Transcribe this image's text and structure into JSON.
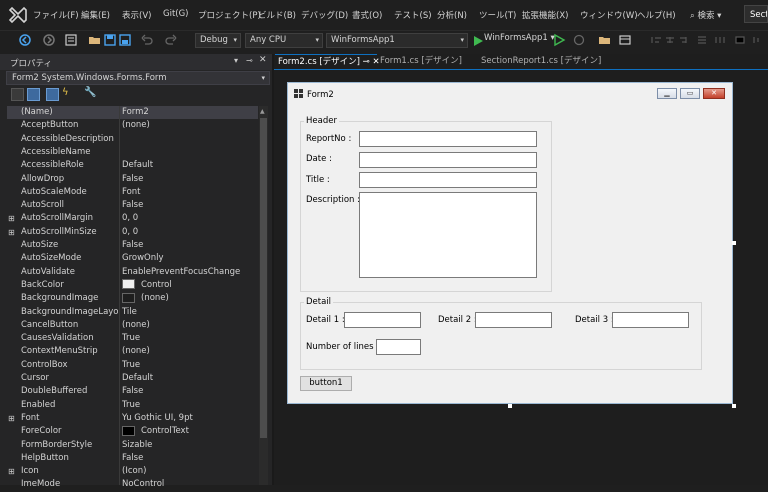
{
  "menubar": {
    "items": [
      "ファイル(F)",
      "編集(E)",
      "表示(V)",
      "Git(G)",
      "プロジェクト(P)",
      "ビルド(B)",
      "デバッグ(D)",
      "書式(O)",
      "テスト(S)",
      "分析(N)",
      "ツール(T)",
      "拡張機能(X)",
      "ウィンドウ(W)",
      "ヘルプ(H)"
    ],
    "search_label": "検索 ▾",
    "search_box_text": "Sect"
  },
  "toolbar": {
    "config": "Debug",
    "platform": "Any CPU",
    "startup_project": "WinFormsApp1",
    "run_label": "WinFormsApp1 ▾"
  },
  "properties": {
    "title": "プロパティ",
    "object": "Form2  System.Windows.Forms.Form",
    "rows": [
      {
        "exp": "",
        "name": "(Name)",
        "value": "Form2"
      },
      {
        "exp": "",
        "name": "AcceptButton",
        "value": "(none)"
      },
      {
        "exp": "",
        "name": "AccessibleDescription",
        "value": ""
      },
      {
        "exp": "",
        "name": "AccessibleName",
        "value": ""
      },
      {
        "exp": "",
        "name": "AccessibleRole",
        "value": "Default"
      },
      {
        "exp": "",
        "name": "AllowDrop",
        "value": "False"
      },
      {
        "exp": "",
        "name": "AutoScaleMode",
        "value": "Font"
      },
      {
        "exp": "",
        "name": "AutoScroll",
        "value": "False"
      },
      {
        "exp": "⊞",
        "name": "AutoScrollMargin",
        "value": "0, 0"
      },
      {
        "exp": "⊞",
        "name": "AutoScrollMinSize",
        "value": "0, 0"
      },
      {
        "exp": "",
        "name": "AutoSize",
        "value": "False"
      },
      {
        "exp": "",
        "name": "AutoSizeMode",
        "value": "GrowOnly"
      },
      {
        "exp": "",
        "name": "AutoValidate",
        "value": "EnablePreventFocusChange"
      },
      {
        "exp": "",
        "name": "BackColor",
        "value": "Control",
        "swatch": "#f0f0f0"
      },
      {
        "exp": "",
        "name": "BackgroundImage",
        "value": "(none)",
        "swatch": "#1e1e1e"
      },
      {
        "exp": "",
        "name": "BackgroundImageLayout",
        "value": "Tile"
      },
      {
        "exp": "",
        "name": "CancelButton",
        "value": "(none)"
      },
      {
        "exp": "",
        "name": "CausesValidation",
        "value": "True"
      },
      {
        "exp": "",
        "name": "ContextMenuStrip",
        "value": "(none)"
      },
      {
        "exp": "",
        "name": "ControlBox",
        "value": "True"
      },
      {
        "exp": "",
        "name": "Cursor",
        "value": "Default"
      },
      {
        "exp": "",
        "name": "DoubleBuffered",
        "value": "False"
      },
      {
        "exp": "",
        "name": "Enabled",
        "value": "True"
      },
      {
        "exp": "⊞",
        "name": "Font",
        "value": "Yu Gothic UI, 9pt"
      },
      {
        "exp": "",
        "name": "ForeColor",
        "value": "ControlText",
        "swatch": "#000000"
      },
      {
        "exp": "",
        "name": "FormBorderStyle",
        "value": "Sizable"
      },
      {
        "exp": "",
        "name": "HelpButton",
        "value": "False"
      },
      {
        "exp": "⊞",
        "name": "Icon",
        "value": "(Icon)"
      },
      {
        "exp": "",
        "name": "ImeMode",
        "value": "NoControl"
      }
    ]
  },
  "tabs": [
    {
      "label": "Form2.cs [デザイン]  ⊸ ✕"
    },
    {
      "label": "Form1.cs [デザイン]"
    },
    {
      "label": "SectionReport1.cs [デザイン]"
    }
  ],
  "form": {
    "title": "Form2",
    "header_group": "Header",
    "report_no_label": "ReportNo :",
    "date_label": "Date :",
    "title_label": "Title :",
    "description_label": "Description :",
    "detail_group": "Detail",
    "detail1_label": "Detail 1 :",
    "detail2_label": "Detail 2 :",
    "detail3_label": "Detail 3 :",
    "lines_label": "Number of lines :",
    "button1": "button1"
  },
  "colors": {
    "accent": "#0e70c0",
    "panel": "#252526",
    "form_bg": "#f0f0f0"
  }
}
